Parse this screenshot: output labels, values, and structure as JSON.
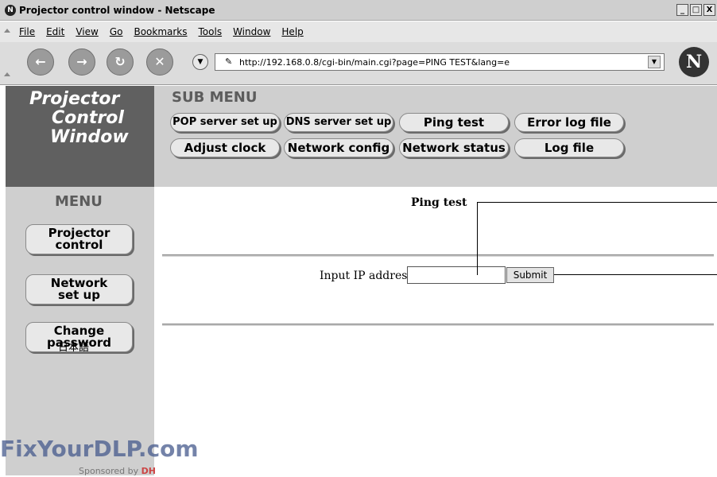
{
  "window": {
    "title": "Projector control window - Netscape",
    "logo_glyph": "N",
    "controls": [
      "_",
      "□",
      "X"
    ]
  },
  "menubar": {
    "items": [
      "File",
      "Edit",
      "View",
      "Go",
      "Bookmarks",
      "Tools",
      "Window",
      "Help"
    ]
  },
  "toolbar": {
    "url": "http://192.168.0.8/cgi-bin/main.cgi?page=PING TEST&lang=e",
    "buttons": [
      {
        "name": "back-button",
        "icon": "back-arrow-icon",
        "glyph": "←"
      },
      {
        "name": "forward-button",
        "icon": "forward-arrow-icon",
        "glyph": "→"
      },
      {
        "name": "reload-button",
        "icon": "reload-icon",
        "glyph": "↻"
      },
      {
        "name": "stop-button",
        "icon": "stop-icon",
        "glyph": "✕"
      }
    ],
    "netscape_glyph": "N"
  },
  "brand": {
    "line1": "Projector",
    "line2": "Control",
    "line3": "Window"
  },
  "submenu": {
    "title": "SUB MENU",
    "items": [
      "POP server set up",
      "DNS server set up",
      "Ping test",
      "Error log file",
      "Adjust clock",
      "Network config",
      "Network status",
      "Log file"
    ]
  },
  "menu": {
    "title": "MENU",
    "items": [
      {
        "l1": "Projector",
        "l2": "control"
      },
      {
        "l1": "Network",
        "l2": "set up"
      },
      {
        "l1": "Change",
        "l2": "password"
      }
    ],
    "language": "日本語"
  },
  "main": {
    "title": "Ping test",
    "ip_label": "Input IP address",
    "ip_value": "",
    "submit_label": "Submit"
  },
  "overlay": {
    "watermark": "FixYourDLP.com",
    "sponsor_prefix": "Sponsored by",
    "sponsor_brand": "DH"
  },
  "colors": {
    "brand_bg": "#606060",
    "panel_bg": "#cfcfcf",
    "button_bg": "#e8e8e8"
  }
}
